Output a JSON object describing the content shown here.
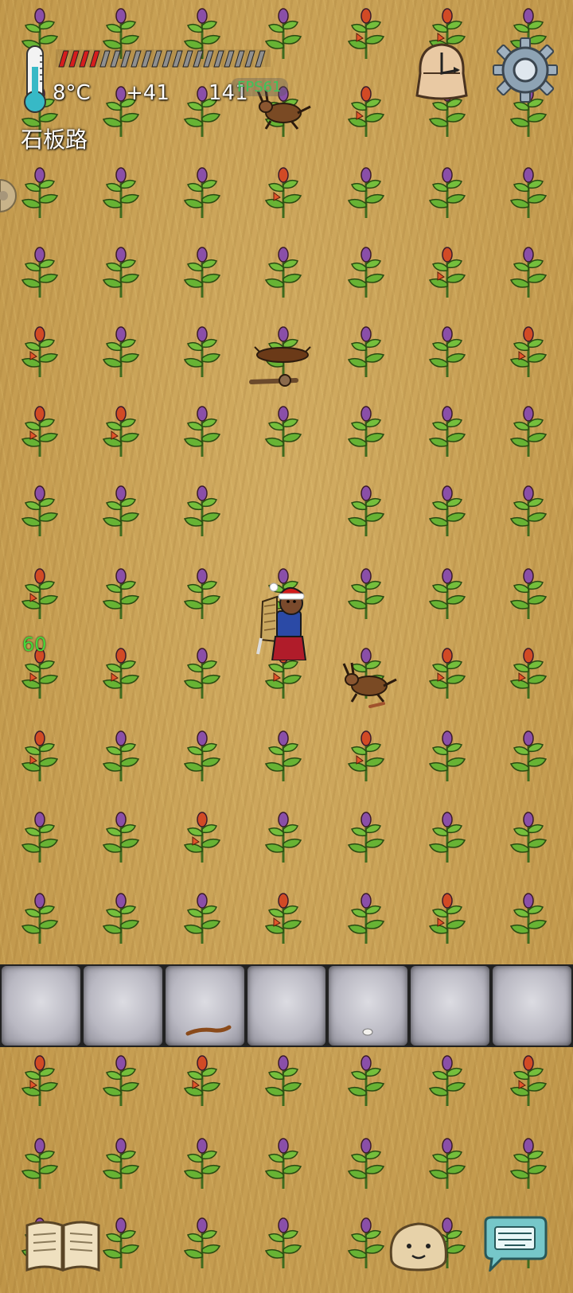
{
  "hud": {
    "temperature": "8°C",
    "food_bonus": "+41",
    "counter": "141",
    "fps_label": "FPS61",
    "location": "石板路",
    "lag_value": "60"
  },
  "colors": {
    "ground": "#c9a257",
    "stone": "#c4c3cc",
    "hunger_fill": "#d61d1d",
    "fps_text": "#3cc45a",
    "lag_text": "#46d63a"
  },
  "icons": {
    "thermometer": "thermometer-icon",
    "hunger_bar": "hunger-bar",
    "clock": "clock-icon",
    "settings": "gear-icon",
    "recipe_book": "book-icon",
    "emote": "emote-face-icon",
    "chat": "keyboard-chat-icon"
  },
  "status": {
    "hunger_fraction": 0.18
  }
}
